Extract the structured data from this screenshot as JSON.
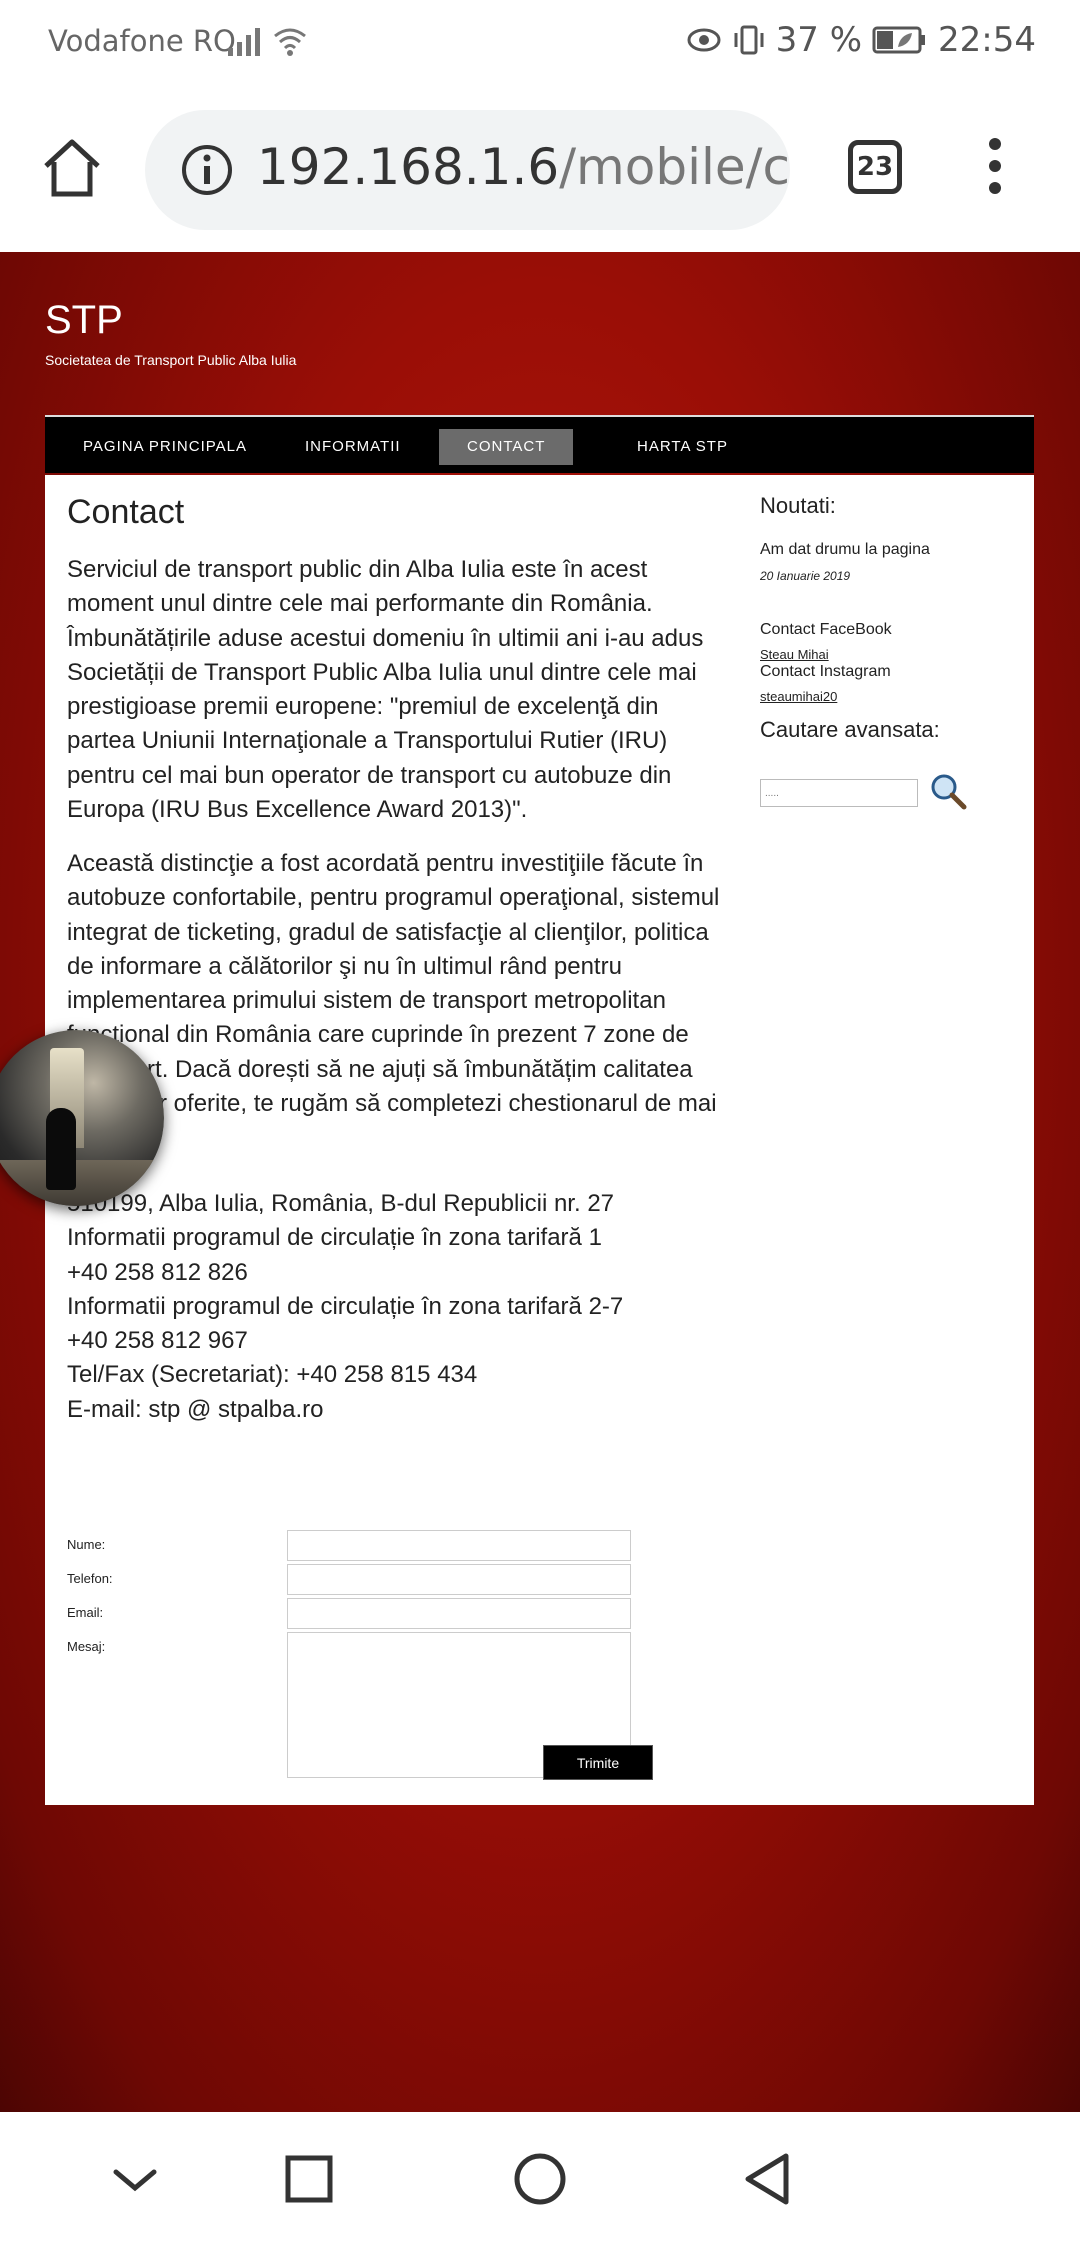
{
  "status_bar": {
    "carrier": "Vodafone RO",
    "battery": "37 %",
    "time": "22:54"
  },
  "browser": {
    "url_host": "192.168.1.6",
    "url_path": "/mobile/cor",
    "tab_count": "23"
  },
  "site": {
    "title": "STP",
    "subtitle": "Societatea de Transport Public Alba Iulia"
  },
  "nav": {
    "items": [
      {
        "label": "PAGINA PRINCIPALA"
      },
      {
        "label": "INFORMATII"
      },
      {
        "label": "CONTACT"
      },
      {
        "label": "HARTA STP"
      }
    ]
  },
  "main": {
    "heading": "Contact",
    "paragraph1": "Serviciul de transport public din Alba Iulia este în acest moment unul dintre cele mai performante din România. Îmbunătățirile aduse acestui domeniu în ultimii ani i-au adus Societății de Transport Public Alba Iulia unul dintre cele mai prestigioase premii europene: \"premiul de excelenţă din partea Uniunii Internaţionale a Transportului Rutier (IRU) pentru cel mai bun operator de transport cu autobuze din Europa (IRU Bus Excellence Award 2013)\".",
    "paragraph2": "Această distincţie a fost acordată pentru investiţiile făcute în autobuze confortabile, pentru programul operaţional, sistemul integrat de ticketing, gradul de satisfacţie al clienţilor, politica de informare a călătorilor şi nu în ultimul rând pentru implementarea primului sistem de transport metropolitan funcţional din România care cuprinde în prezent 7 zone de transport. Dacă dorești să ne ajuți să îmbunătățim calitatea serviciilor oferite, te rugăm să completezi chestionarul de mai jos:",
    "contact_lines": [
      "510199, Alba Iulia, România, B-dul Republicii nr. 27",
      "Informatii programul de circulație în zona tarifară 1",
      "+40 258 812 826",
      "Informatii programul de circulație în zona tarifară 2-7",
      "+40 258 812 967",
      "Tel/Fax (Secretariat): +40 258 815 434",
      "E-mail: stp @ stpalba.ro"
    ],
    "form": {
      "name_label": "Nume:",
      "phone_label": "Telefon:",
      "email_label": "Email:",
      "message_label": "Mesaj:",
      "submit_label": "Trimite"
    }
  },
  "sidebar": {
    "news_heading": "Noutati:",
    "news_item": "Am dat drumu la pagina",
    "news_date": "20 Ianuarie 2019",
    "facebook_label": "Contact FaceBook",
    "facebook_link": "Steau Mihai",
    "instagram_label": "Contact Instagram",
    "instagram_link": "steaumihai20",
    "search_heading": "Cautare avansata:",
    "search_placeholder": "....."
  },
  "colors": {
    "page_background": "#9a0e06",
    "nav_background": "#000000",
    "nav_active": "#6b6b6b"
  }
}
